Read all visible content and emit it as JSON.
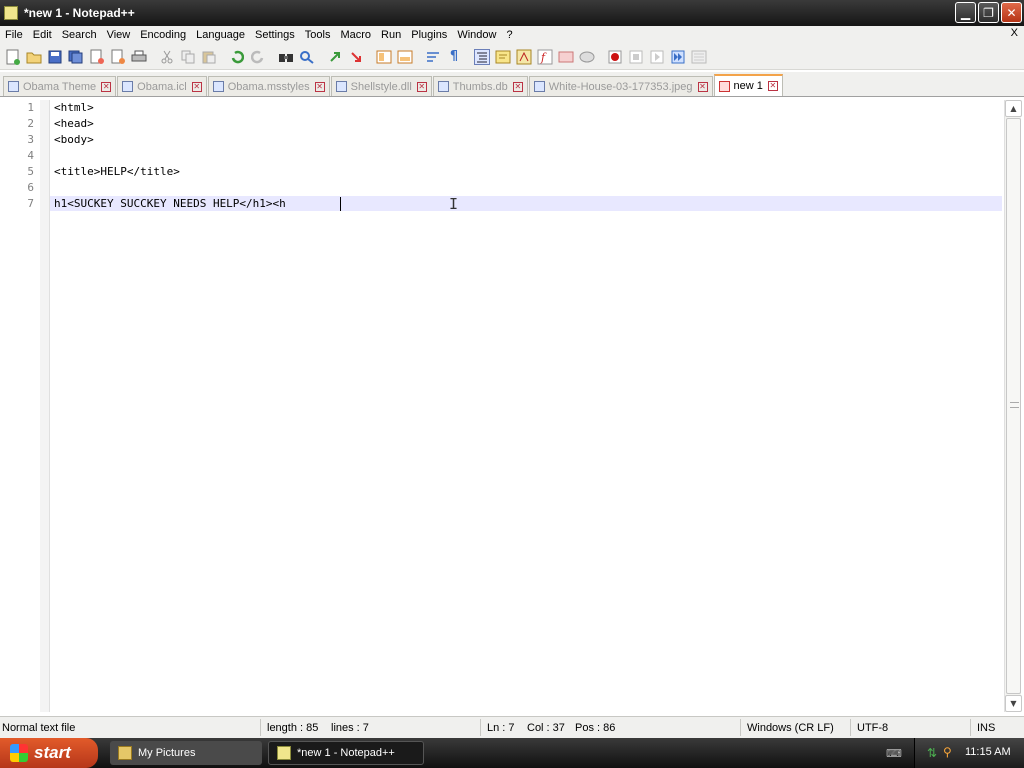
{
  "window": {
    "title": "*new 1 - Notepad++"
  },
  "menu": [
    "File",
    "Edit",
    "Search",
    "View",
    "Encoding",
    "Language",
    "Settings",
    "Tools",
    "Macro",
    "Run",
    "Plugins",
    "Window",
    "?"
  ],
  "menu_close": "X",
  "toolbar_icons": [
    "new-file-icon",
    "open-file-icon",
    "save-icon",
    "save-all-icon",
    "close-icon",
    "close-all-icon",
    "print-icon",
    "cut-icon",
    "copy-icon",
    "paste-icon",
    "undo-icon",
    "redo-icon",
    "find-icon",
    "replace-icon",
    "zoom-in-icon",
    "zoom-out-icon",
    "sync-v-icon",
    "sync-h-icon",
    "word-wrap-icon",
    "show-all-chars-icon",
    "indent-guide-icon",
    "user-lang-icon",
    "doc-map-icon",
    "function-list-icon",
    "folder-workspace-icon",
    "monitor-icon",
    "record-macro-icon",
    "stop-macro-icon",
    "play-macro-icon",
    "run-macro-multiple-icon",
    "save-macro-icon"
  ],
  "tabs": [
    {
      "label": "Obama Theme",
      "active": false
    },
    {
      "label": "Obama.icl",
      "active": false
    },
    {
      "label": "Obama.msstyles",
      "active": false
    },
    {
      "label": "Shellstyle.dll",
      "active": false
    },
    {
      "label": "Thumbs.db",
      "active": false
    },
    {
      "label": "White-House-03-177353.jpeg",
      "active": false
    },
    {
      "label": "new 1",
      "active": true
    }
  ],
  "editor": {
    "lines": [
      {
        "num": "1",
        "text": "<html>"
      },
      {
        "num": "2",
        "text": "<head>"
      },
      {
        "num": "3",
        "text": "<body>"
      },
      {
        "num": "4",
        "text": ""
      },
      {
        "num": "5",
        "text": "<title>HELP</title>"
      },
      {
        "num": "6",
        "text": ""
      },
      {
        "num": "7",
        "text": "h1<SUCKEY SUCCKEY NEEDS HELP</h1><h "
      }
    ],
    "current_line": 7
  },
  "status": {
    "file_type": "Normal text file",
    "length": "length : 85",
    "lines": "lines : 7",
    "ln": "Ln : 7",
    "col": "Col : 37",
    "pos": "Pos : 86",
    "eol": "Windows (CR LF)",
    "encoding": "UTF-8",
    "mode": "INS"
  },
  "taskbar": {
    "start_label": "start",
    "tasks": [
      {
        "label": "My Pictures",
        "active": false
      },
      {
        "label": "*new 1 - Notepad++",
        "active": true
      }
    ],
    "clock": "11:15 AM"
  }
}
